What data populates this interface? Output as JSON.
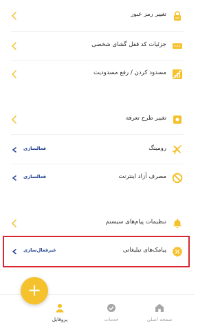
{
  "colors": {
    "accent": "#f5c12c",
    "link": "#1f3f8f",
    "highlight": "#d8252e",
    "inactive": "#a6a6a6"
  },
  "settings": {
    "change_password": {
      "label": "تغییر رمز عبور",
      "icon": "lock-icon"
    },
    "pin_lock": {
      "label": "جزئیات کد قفل گشای شخصی",
      "icon": "pin-code-icon"
    },
    "block_unblock": {
      "label": "مسدود کردن / رفع مسدودیت",
      "icon": "block-signal-icon"
    },
    "change_tariff": {
      "label": "تغییر طرح تعرفه",
      "icon": "tariff-icon"
    },
    "roaming": {
      "label": "رومینگ",
      "status": "فعالسازی",
      "icon": "airplane-icon"
    },
    "free_internet": {
      "label": "مصرف آزاد اینترنت",
      "status": "فعالسازی",
      "icon": "no-sign-icon"
    },
    "system_messages": {
      "label": "تنظیمات پیام‌های سیستم",
      "icon": "bell-icon"
    },
    "ad_sms": {
      "label": "پیامک‌های تبلیغاتی",
      "status": "غیرفعال‌سازی",
      "icon": "megaphone-badge-icon"
    }
  },
  "fab": {
    "label": "+"
  },
  "nav": {
    "home": {
      "label": "صفحه اصلی",
      "icon": "home-icon"
    },
    "services": {
      "label": "خدمات",
      "icon": "services-icon"
    },
    "profile": {
      "label": "پروفایل",
      "icon": "profile-icon"
    }
  }
}
